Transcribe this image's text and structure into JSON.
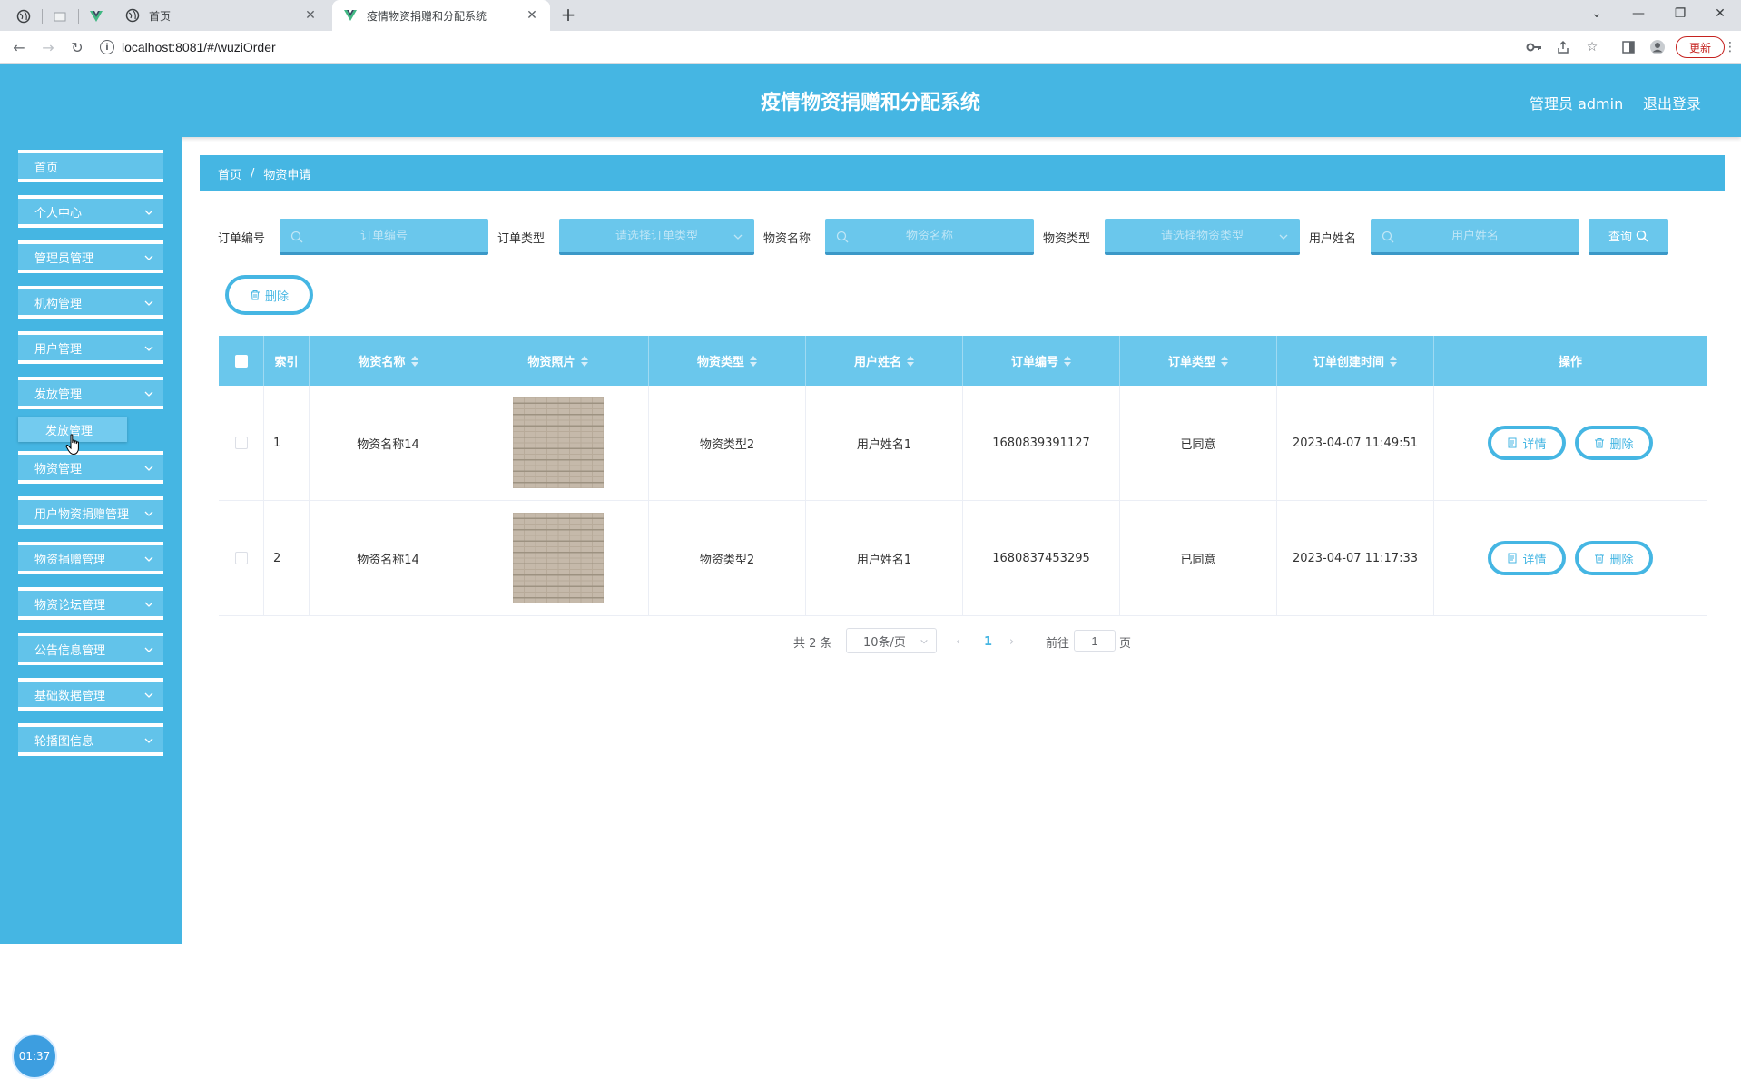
{
  "browser": {
    "tabs": [
      {
        "title": "首页"
      },
      {
        "title": "疫情物资捐赠和分配系统"
      }
    ],
    "url": "localhost:8081/#/wuziOrder",
    "update_label": "更新"
  },
  "header": {
    "title": "疫情物资捐赠和分配系统",
    "admin": "管理员 admin",
    "logout": "退出登录"
  },
  "sidebar": {
    "items": [
      {
        "label": "首页"
      },
      {
        "label": "个人中心"
      },
      {
        "label": "管理员管理"
      },
      {
        "label": "机构管理"
      },
      {
        "label": "用户管理"
      },
      {
        "label": "发放管理"
      },
      {
        "label": "物资管理"
      },
      {
        "label": "用户物资捐赠管理"
      },
      {
        "label": "物资捐赠管理"
      },
      {
        "label": "物资论坛管理"
      },
      {
        "label": "公告信息管理"
      },
      {
        "label": "基础数据管理"
      },
      {
        "label": "轮播图信息"
      }
    ],
    "submenu": {
      "label": "发放管理"
    },
    "clock": "01:37"
  },
  "breadcrumb": {
    "home": "首页",
    "sep": "/",
    "current": "物资申请"
  },
  "search": {
    "order_no_label": "订单编号",
    "order_no_placeholder": "订单编号",
    "order_type_label": "订单类型",
    "order_type_placeholder": "请选择订单类型",
    "material_name_label": "物资名称",
    "material_name_placeholder": "物资名称",
    "material_type_label": "物资类型",
    "material_type_placeholder": "请选择物资类型",
    "user_name_label": "用户姓名",
    "user_name_placeholder": "用户姓名",
    "query_label": "查询"
  },
  "actions": {
    "delete_label": "删除"
  },
  "table": {
    "headers": {
      "index": "索引",
      "name": "物资名称",
      "photo": "物资照片",
      "type": "物资类型",
      "user": "用户姓名",
      "order_no": "订单编号",
      "order_type": "订单类型",
      "created": "订单创建时间",
      "ops": "操作"
    },
    "detail_label": "详情",
    "delete_label": "删除",
    "rows": [
      {
        "index": "1",
        "name": "物资名称14",
        "type": "物资类型2",
        "user": "用户姓名1",
        "order_no": "1680839391127",
        "order_type": "已同意",
        "created": "2023-04-07 11:49:51"
      },
      {
        "index": "2",
        "name": "物资名称14",
        "type": "物资类型2",
        "user": "用户姓名1",
        "order_no": "1680837453295",
        "order_type": "已同意",
        "created": "2023-04-07 11:17:33"
      }
    ]
  },
  "pagination": {
    "total": "共 2 条",
    "page_size": "10条/页",
    "current_page": "1",
    "goto_label": "前往",
    "goto_value": "1",
    "page_suffix": "页"
  }
}
